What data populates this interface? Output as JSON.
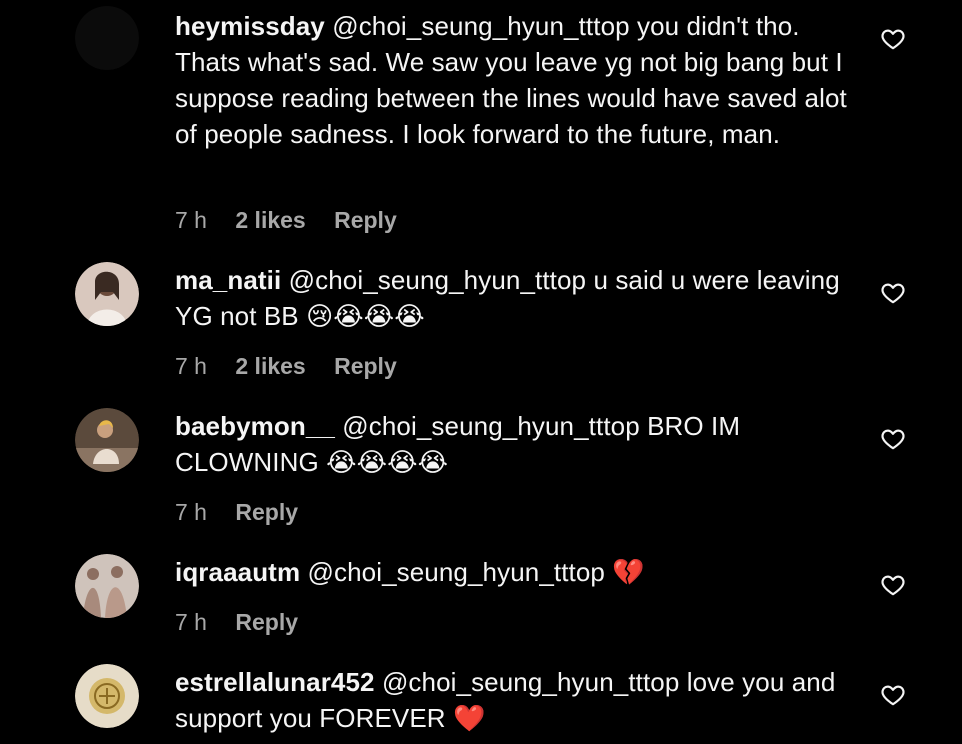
{
  "comments": [
    {
      "username": "heymissday",
      "mention": "@choi_seung_hyun_tttop",
      "body": "you didn't tho. Thats what's sad. We saw you leave yg not big bang but I suppose reading between the lines would have saved alot of people sadness. I look forward to the future, man.",
      "time": "7 h",
      "likes": "2 likes",
      "reply": "Reply",
      "avatar_color": "#0b0b0b"
    },
    {
      "username": "ma_natii",
      "mention": "@choi_seung_hyun_tttop",
      "body": "u said u were leaving YG not BB 😢😭😭😭",
      "time": "7 h",
      "likes": "2 likes",
      "reply": "Reply",
      "avatar_color": "#d9c8be"
    },
    {
      "username": "baebymon__",
      "mention": "@choi_seung_hyun_tttop",
      "body": "BRO IM CLOWNING 😭😭😭😭",
      "time": "7 h",
      "reply": "Reply",
      "avatar_color": "#5b4a3c"
    },
    {
      "username": "iqraaautm",
      "mention": "@choi_seung_hyun_tttop",
      "body": "💔",
      "time": "7 h",
      "reply": "Reply",
      "avatar_color": "#a88a7c"
    },
    {
      "username": "estrellalunar452",
      "mention": "@choi_seung_hyun_tttop",
      "body": "love you and support you FOREVER ❤️",
      "avatar_color": "#e6dcc8"
    }
  ],
  "icons": {
    "like": "heart-outline-icon"
  },
  "colors": {
    "background": "#000000",
    "text": "#f5f5f5",
    "meta": "#a8a8a8"
  }
}
